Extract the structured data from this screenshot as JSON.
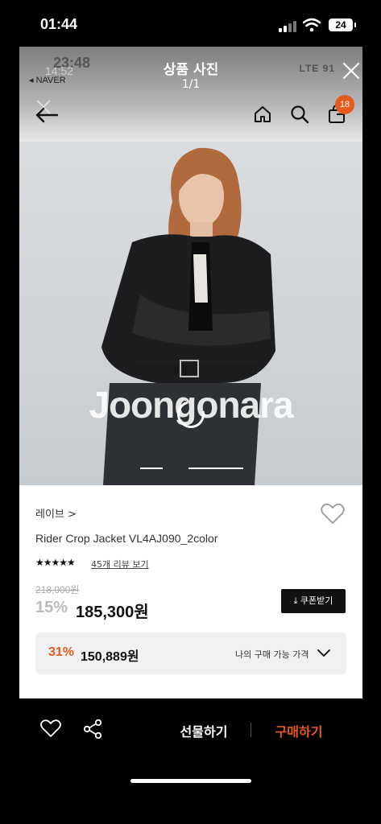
{
  "status_bar": {
    "time": "01:44",
    "battery": "24"
  },
  "viewer": {
    "ghost_time": "23:48",
    "ghost_time_small": "14:52",
    "back_app": "◂ NAVER",
    "ghost_status": "LTE 91",
    "title": "상품 사진",
    "count": "1/1",
    "cart_count": "18"
  },
  "photo": {
    "watermark": "Joongonara"
  },
  "product": {
    "brand": "레이브 >",
    "name": "Rider Crop Jacket VL4AJ090_2color",
    "stars": "★★★★★",
    "reviews": "45개 리뷰 보기",
    "original_price": "218,000원",
    "discount": "15%",
    "price": "185,300원",
    "coupon_label": "⤓ 쿠폰받기",
    "my_discount": "31%",
    "my_price": "150,889원",
    "my_price_label": "나의 구매 가능 가격"
  },
  "bottom_bar": {
    "gift_label": "선물하기",
    "buy_label": "구매하기"
  },
  "colors": {
    "accent": "#e65a1e",
    "dark": "#111111"
  }
}
